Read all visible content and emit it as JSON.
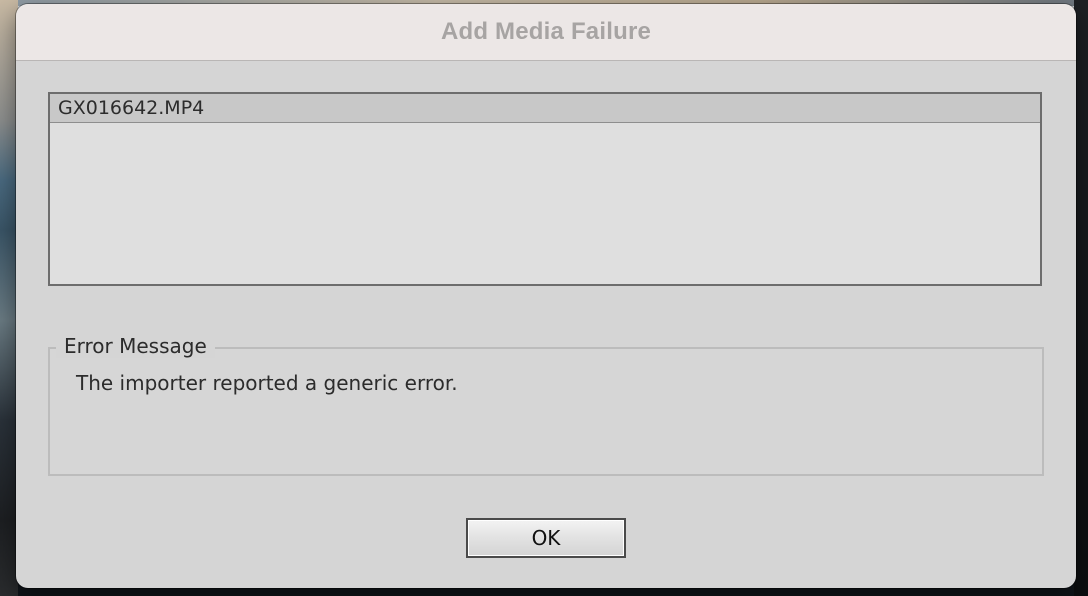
{
  "dialog": {
    "title": "Add Media Failure"
  },
  "file_list": {
    "items": [
      "GX016642.MP4"
    ]
  },
  "error_group": {
    "legend": "Error Message",
    "message": "The importer reported a generic error."
  },
  "buttons": {
    "ok_label": "OK"
  }
}
